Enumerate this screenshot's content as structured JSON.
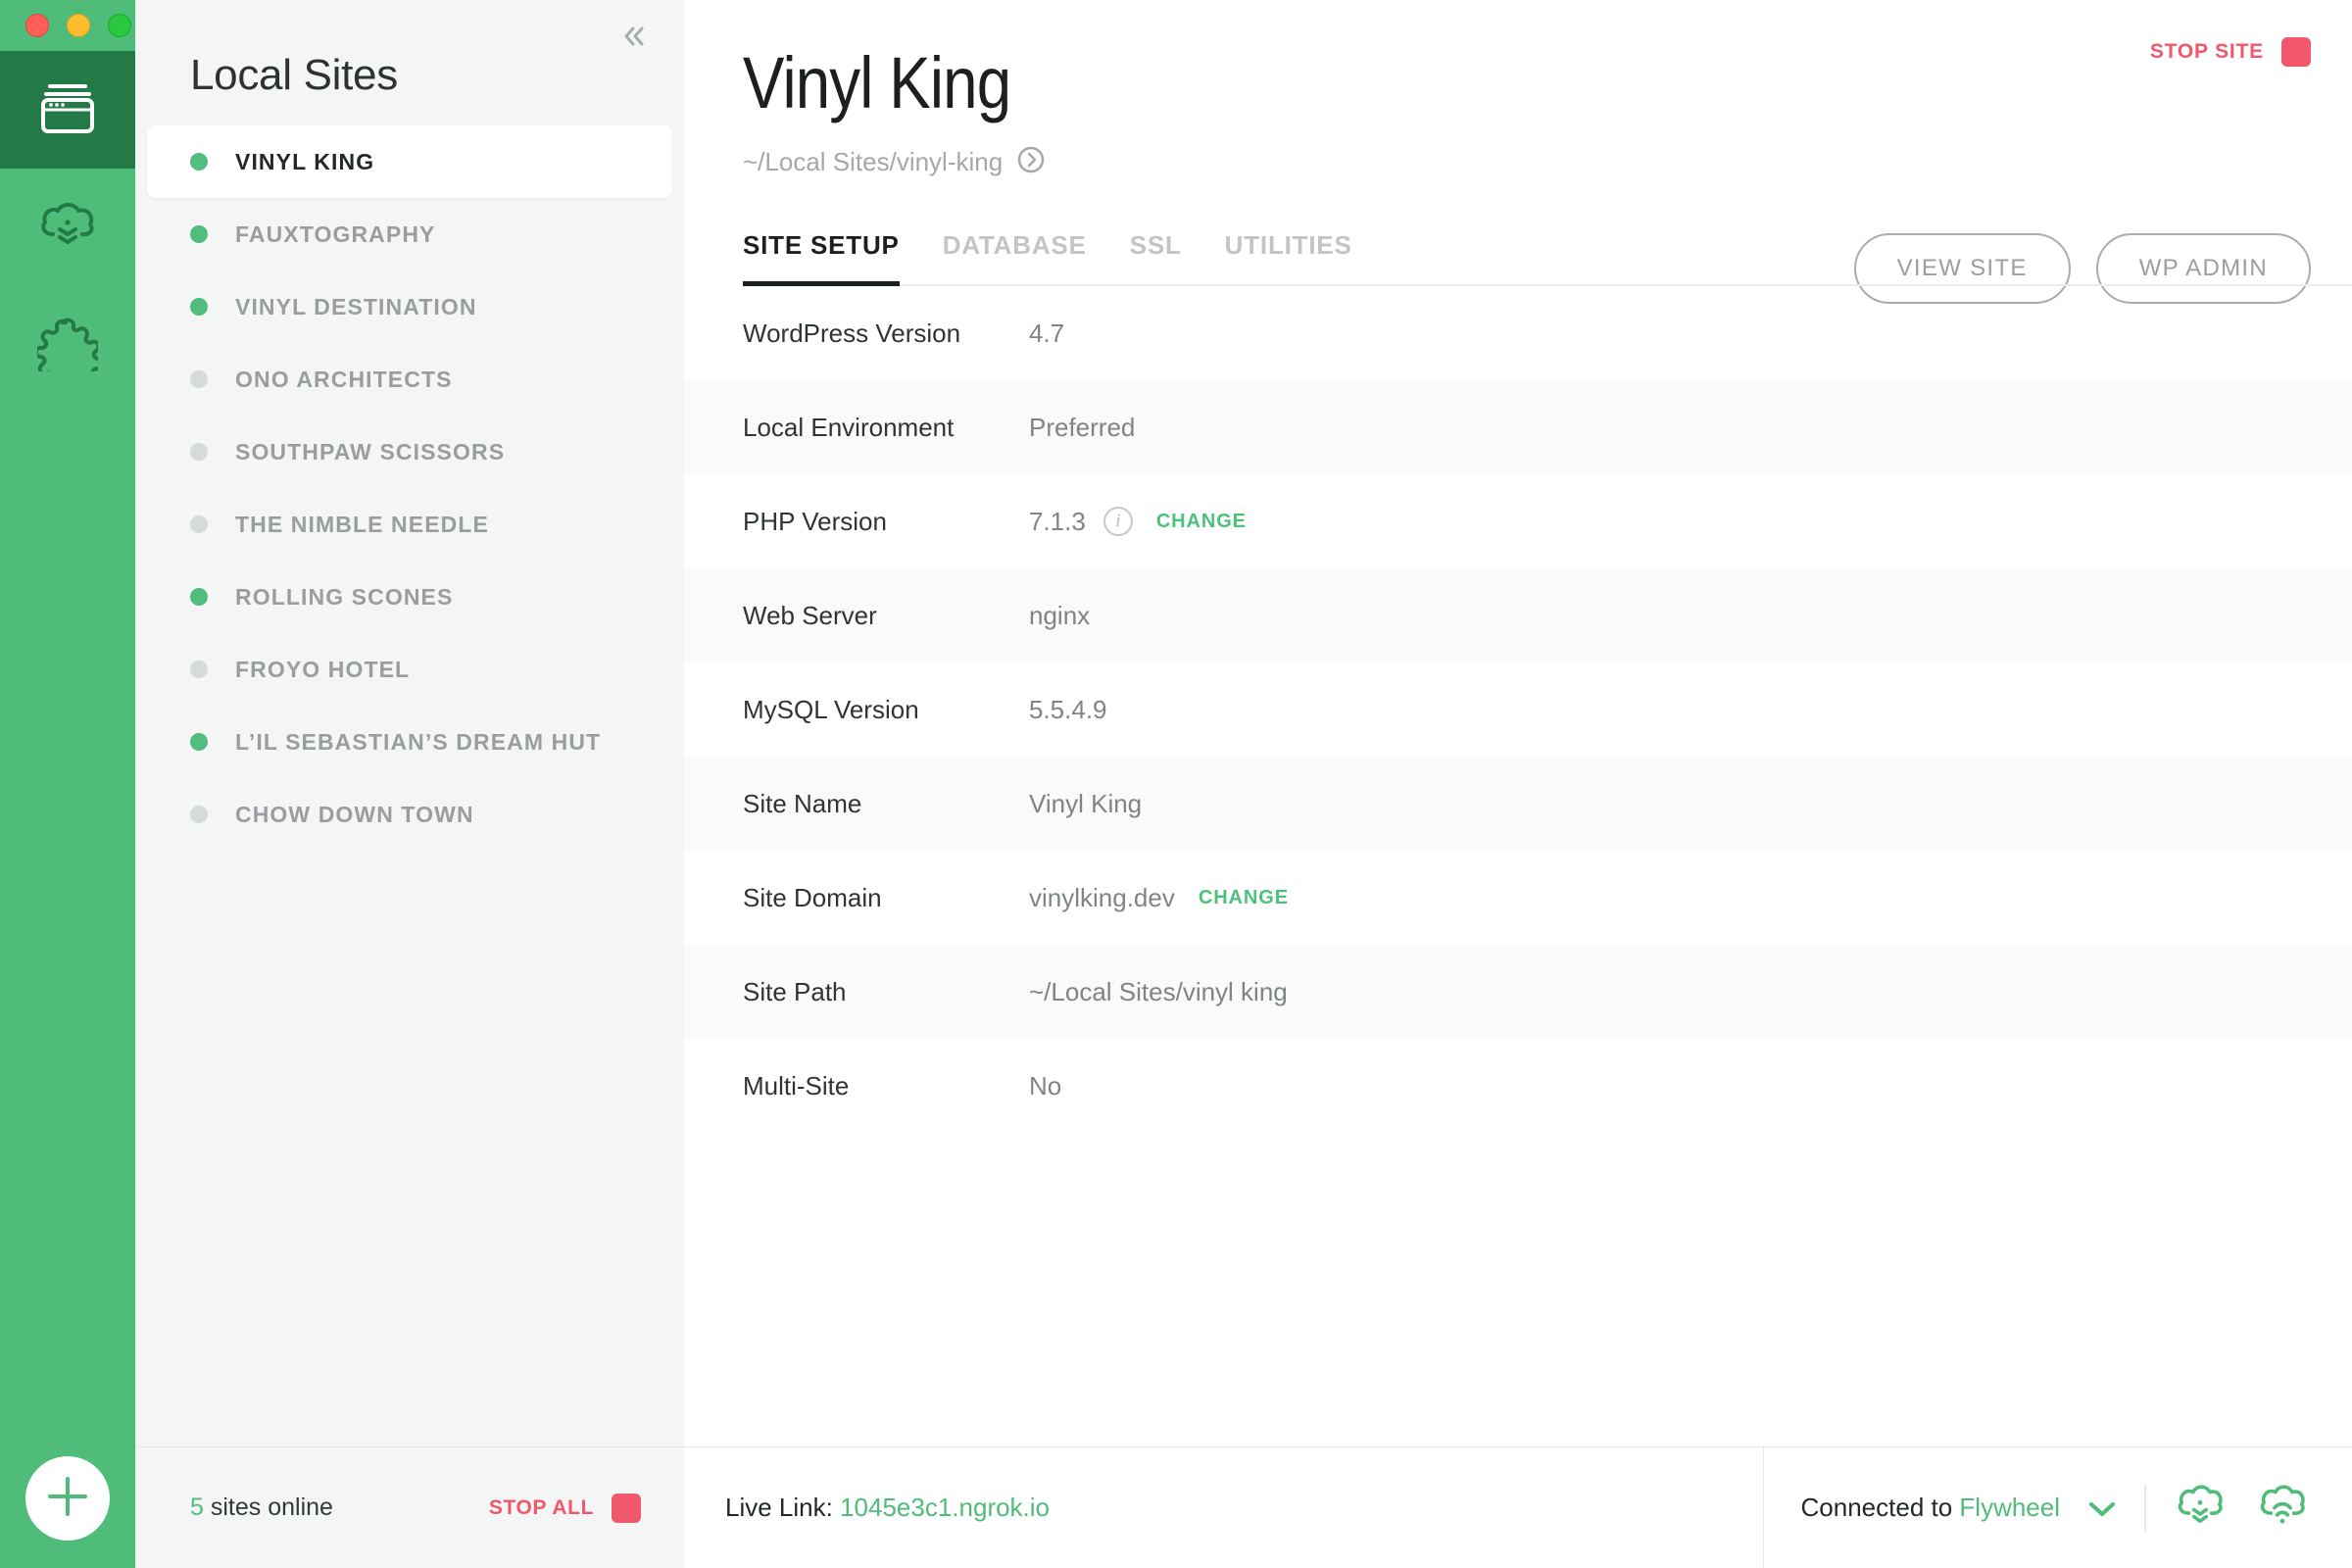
{
  "window": {
    "traffic_lights": [
      "close",
      "minimize",
      "maximize"
    ]
  },
  "rail": {
    "items": [
      {
        "name": "sites",
        "icon": "sites-window-icon",
        "active": true
      },
      {
        "name": "cloud-backups",
        "icon": "cloud-download-icon",
        "active": false
      },
      {
        "name": "add-ons",
        "icon": "puzzle-piece-icon",
        "active": false
      }
    ],
    "add_button_icon": "plus-icon"
  },
  "sidebar": {
    "title": "Local Sites",
    "collapse_icon": "chevron-double-left-icon",
    "sites": [
      {
        "name": "VINYL KING",
        "online": true,
        "selected": true
      },
      {
        "name": "FAUXTOGRAPHY",
        "online": true,
        "selected": false
      },
      {
        "name": "VINYL DESTINATION",
        "online": true,
        "selected": false
      },
      {
        "name": "ONO ARCHITECTS",
        "online": false,
        "selected": false
      },
      {
        "name": "SOUTHPAW SCISSORS",
        "online": false,
        "selected": false
      },
      {
        "name": "THE NIMBLE NEEDLE",
        "online": false,
        "selected": false
      },
      {
        "name": "ROLLING SCONES",
        "online": true,
        "selected": false
      },
      {
        "name": "FROYO HOTEL",
        "online": false,
        "selected": false
      },
      {
        "name": "L’IL SEBASTIAN’S DREAM HUT",
        "online": true,
        "selected": false
      },
      {
        "name": "CHOW DOWN TOWN",
        "online": false,
        "selected": false
      }
    ],
    "footer": {
      "online_count": "5",
      "online_label": " sites online",
      "stop_all_label": "STOP ALL"
    }
  },
  "main": {
    "stop_site_label": "STOP SITE",
    "site_title": "Vinyl King",
    "site_path": "~/Local Sites/vinyl-king",
    "site_path_icon": "arrow-right-circle-icon",
    "actions": [
      {
        "label": "VIEW SITE",
        "name": "view-site-button"
      },
      {
        "label": "WP ADMIN",
        "name": "wp-admin-button"
      }
    ],
    "tabs": [
      {
        "label": "SITE SETUP",
        "active": true
      },
      {
        "label": "DATABASE",
        "active": false
      },
      {
        "label": "SSL",
        "active": false
      },
      {
        "label": "UTILITIES",
        "active": false
      }
    ],
    "rows": [
      {
        "key": "WordPress Version",
        "value": "4.7",
        "info": false,
        "change": null
      },
      {
        "key": "Local Environment",
        "value": "Preferred",
        "info": false,
        "change": null
      },
      {
        "key": "PHP Version",
        "value": "7.1.3",
        "info": true,
        "change": "CHANGE"
      },
      {
        "key": "Web Server",
        "value": "nginx",
        "info": false,
        "change": null
      },
      {
        "key": "MySQL Version",
        "value": "5.5.4.9",
        "info": false,
        "change": null
      },
      {
        "key": "Site Name",
        "value": "Vinyl King",
        "info": false,
        "change": null
      },
      {
        "key": "Site Domain",
        "value": "vinylking.dev",
        "info": false,
        "change": "CHANGE"
      },
      {
        "key": "Site Path",
        "value": "~/Local Sites/vinyl king",
        "info": false,
        "change": null
      },
      {
        "key": "Multi-Site",
        "value": "No",
        "info": false,
        "change": null
      }
    ],
    "footer": {
      "live_link_label": "Live Link: ",
      "live_link_url": "1045e3c1.ngrok.io",
      "connected_label": "Connected to ",
      "connected_provider": "Flywheel",
      "caret_icon": "chevron-down-icon",
      "pull_icon": "cloud-download-icon",
      "push_icon": "cloud-upload-icon"
    }
  },
  "colors": {
    "brand_green": "#4fbc79",
    "rail_active": "#237a46",
    "danger_pink": "#f1576d",
    "link_green": "#4cc17c",
    "sidebar_bg": "#f4f5f5"
  }
}
